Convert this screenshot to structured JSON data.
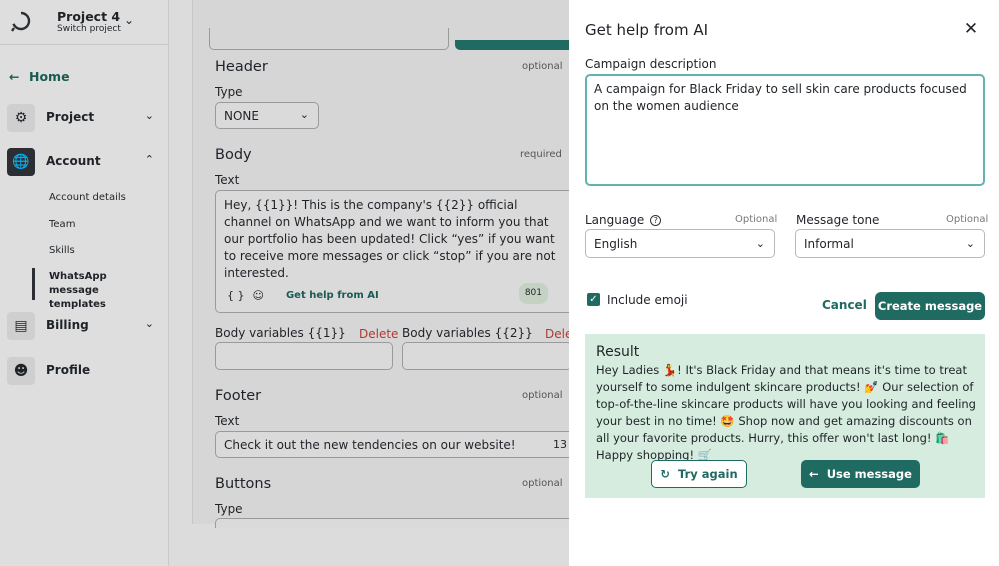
{
  "project": {
    "name": "Project 4",
    "switch_label": "Switch project"
  },
  "sidebar": {
    "home": "Home",
    "items": [
      {
        "label": "Project"
      },
      {
        "label": "Account"
      },
      {
        "label": "Billing"
      },
      {
        "label": "Profile"
      }
    ],
    "account_sub": [
      "Account details",
      "Team",
      "Skills",
      "WhatsApp message templates"
    ]
  },
  "main": {
    "header": {
      "title": "Header",
      "tag": "optional",
      "type_label": "Type",
      "type_value": "NONE"
    },
    "body": {
      "title": "Body",
      "tag": "required",
      "text_label": "Text",
      "text": "Hey, {{1}}! This is the company's {{2}} official channel on WhatsApp and we want to inform you that our portfolio has been updated! Click “yes” if you want to receive more messages or click “stop” if you are not interested.",
      "help_ai": "Get help from AI",
      "count": "801",
      "var1_label": "Body variables {{1}}",
      "var2_label": "Body variables {{2}}",
      "delete": "Delete",
      "delete_cut": "Dele"
    },
    "footer": {
      "title": "Footer",
      "tag": "optional",
      "text_label": "Text",
      "text": "Check it out the new tendencies on our website!",
      "count": "13"
    },
    "buttons": {
      "title": "Buttons",
      "tag": "optional",
      "type_label": "Type"
    }
  },
  "drawer": {
    "title": "Get help from AI",
    "campaign_label": "Campaign description",
    "campaign_value": "A campaign for Black Friday to sell skin care products focused on the women audience",
    "language_label": "Language",
    "language_optional": "Optional",
    "language_value": "English",
    "tone_label": "Message tone",
    "tone_optional": "Optional",
    "tone_value": "Informal",
    "emoji_label": "Include emoji",
    "cancel": "Cancel",
    "create": "Create message",
    "result_title": "Result",
    "result_text": "Hey Ladies 💃! It's Black Friday and that means it's time to treat yourself to some indulgent skincare products! 💅 Our selection of top-of-the-line skincare products will have you looking and feeling your best in no time! 🤩 Shop now and get amazing discounts on all your favorite products. Hurry, this offer won't last long! 🛍️ Happy shopping! 🛒",
    "try_again": "Try again",
    "use_message": "Use message"
  },
  "colors": {
    "accent": "#1f6b62",
    "result_bg": "#d5ecdf",
    "focus": "#63b2ae"
  }
}
